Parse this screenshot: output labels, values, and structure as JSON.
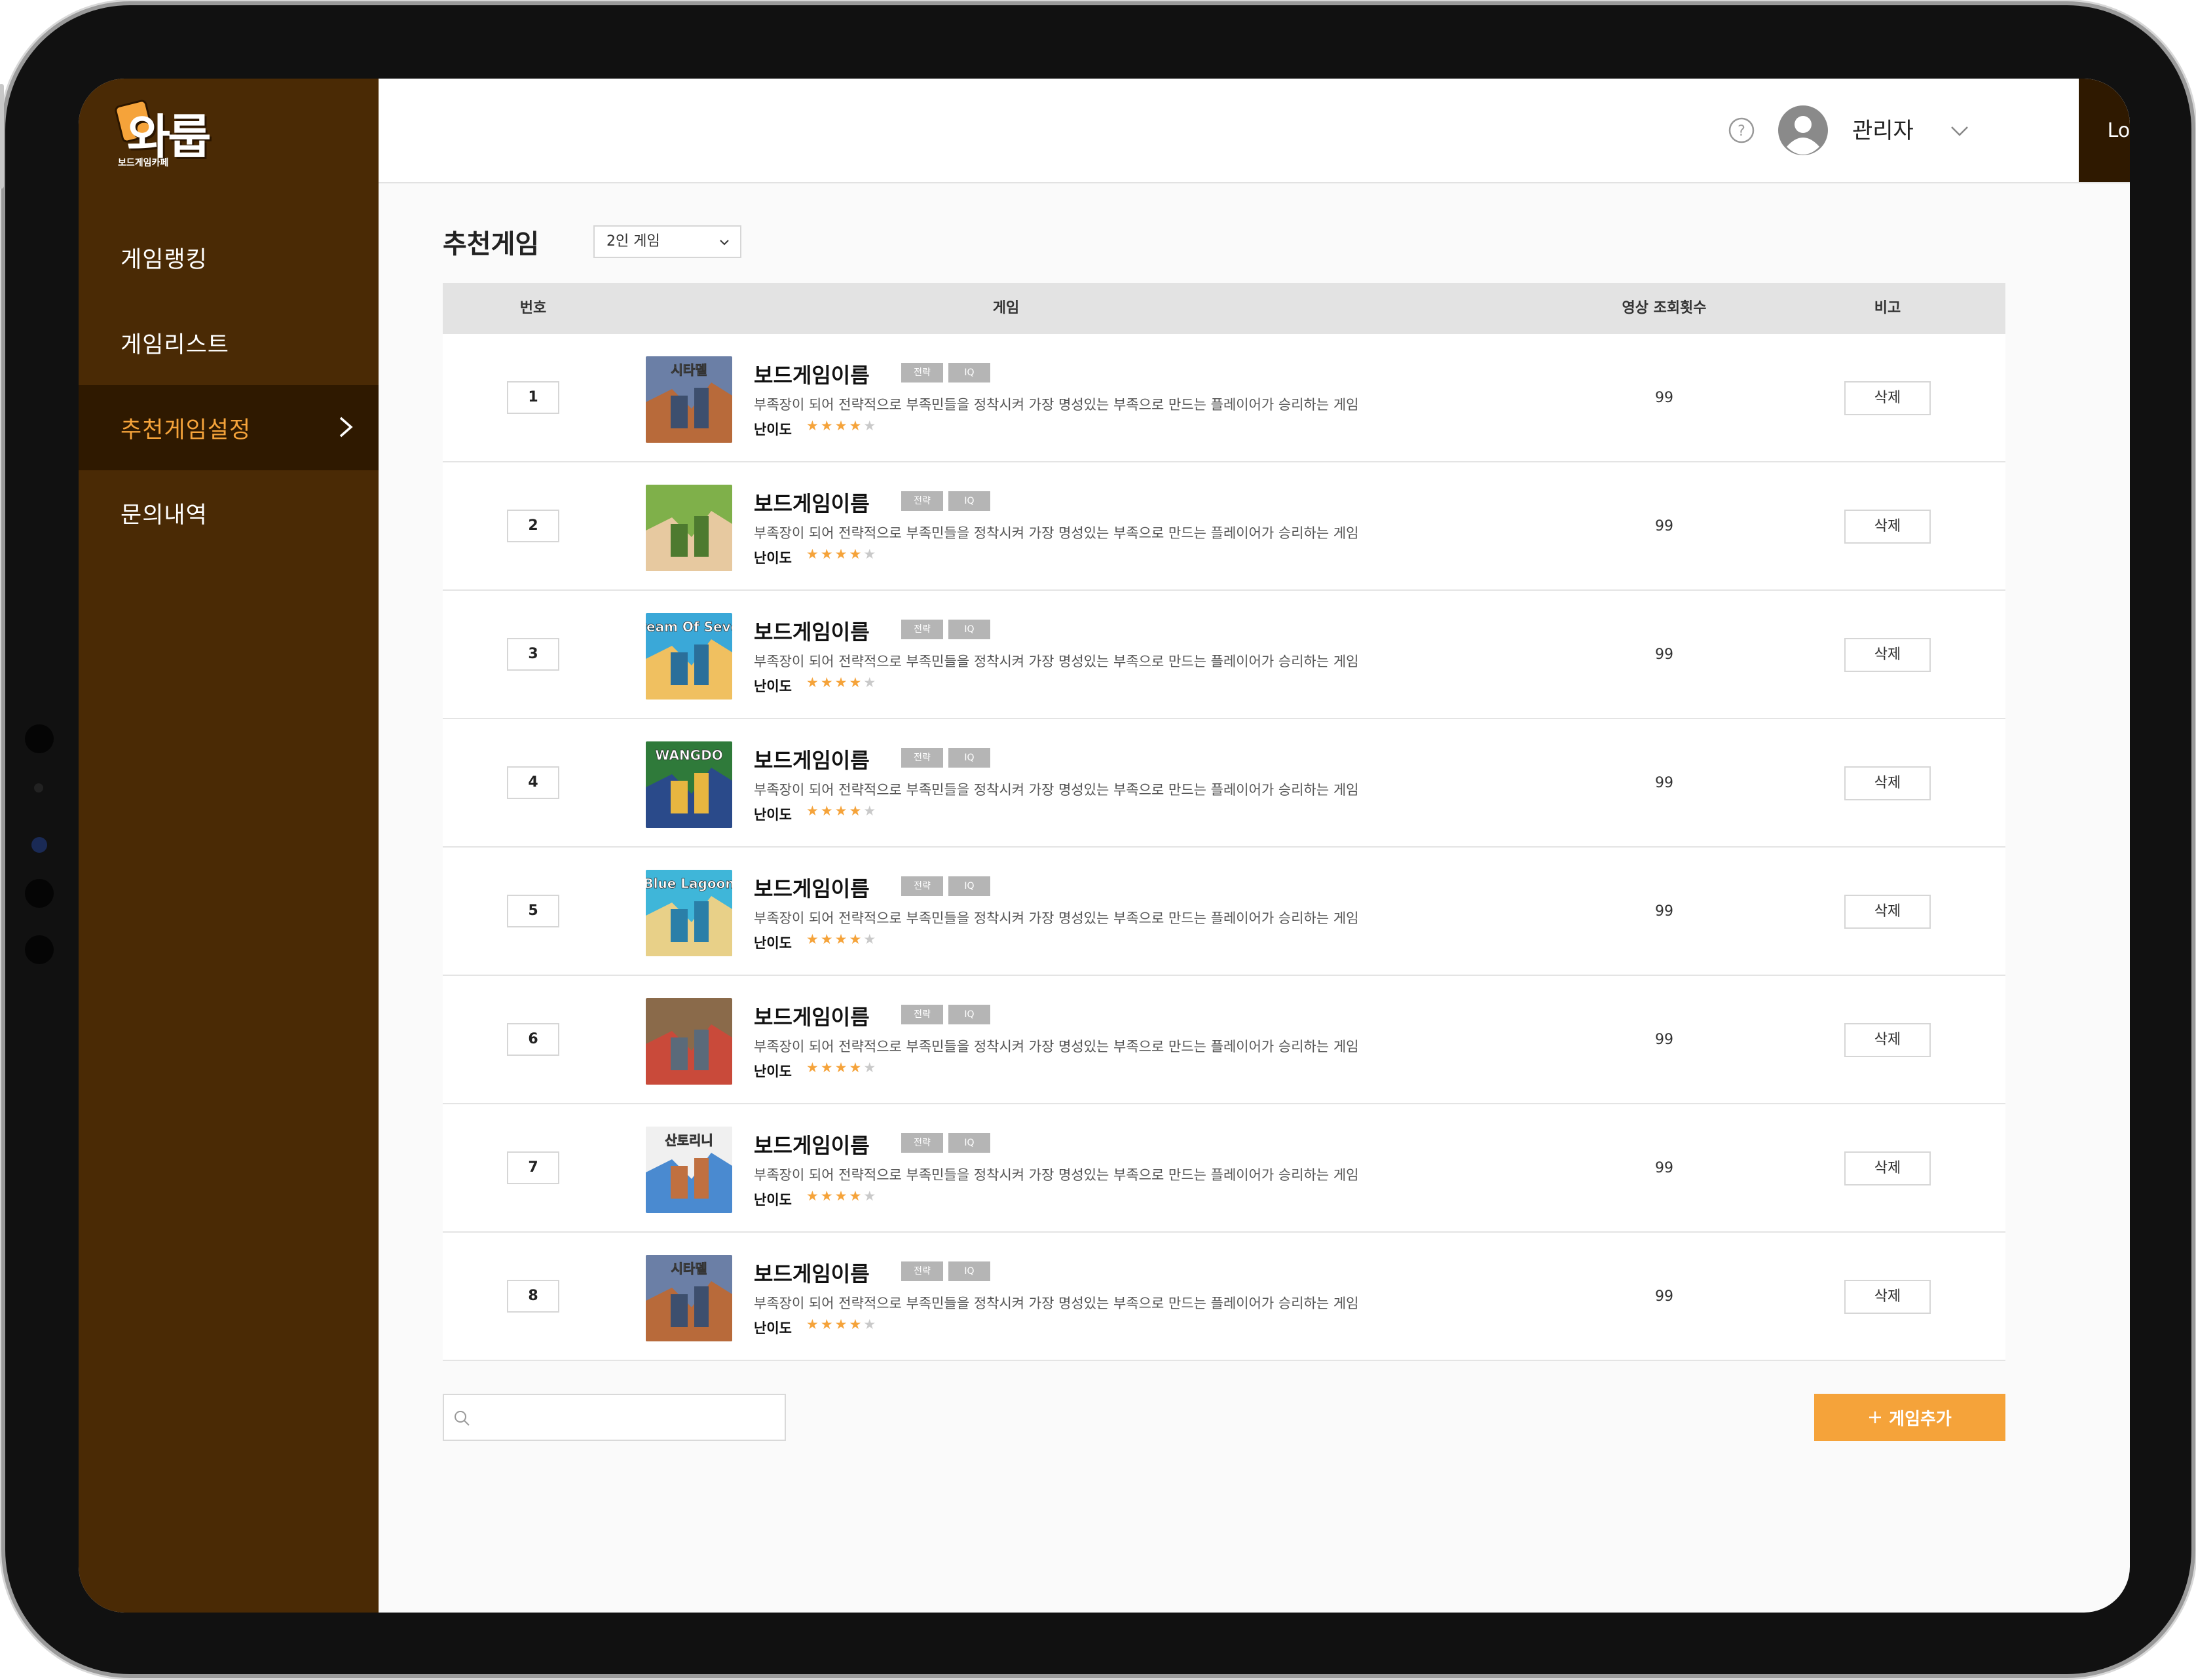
{
  "app": {
    "logo_main": "와룹",
    "logo_sub": "보드게임카페"
  },
  "sidebar": {
    "items": [
      {
        "label": "게임랭킹"
      },
      {
        "label": "게임리스트"
      },
      {
        "label": "추천게임설정"
      },
      {
        "label": "문의내역"
      }
    ],
    "active_index": 2
  },
  "header": {
    "user_name": "관리자",
    "logout_label": "Logout"
  },
  "page": {
    "title": "추천게임",
    "filter_selected": "2인 게임"
  },
  "table": {
    "headers": [
      "번호",
      "게임",
      "영상 조회횟수",
      "비고"
    ],
    "rows": [
      {
        "num": "1",
        "name": "보드게임이름",
        "tag1": "전략",
        "tag2": "IQ",
        "desc": "부족장이 되어 전략적으로 부족민들을 정착시켜 가장 명성있는 부족으로 만드는 플레이어가 승리하는 게임",
        "diff_label": "난이도",
        "stars": 4,
        "views": "99",
        "action": "삭제"
      },
      {
        "num": "2",
        "name": "보드게임이름",
        "tag1": "전략",
        "tag2": "IQ",
        "desc": "부족장이 되어 전략적으로 부족민들을 정착시켜 가장 명성있는 부족으로 만드는 플레이어가 승리하는 게임",
        "diff_label": "난이도",
        "stars": 4,
        "views": "99",
        "action": "삭제"
      },
      {
        "num": "3",
        "name": "보드게임이름",
        "tag1": "전략",
        "tag2": "IQ",
        "desc": "부족장이 되어 전략적으로 부족민들을 정착시켜 가장 명성있는 부족으로 만드는 플레이어가 승리하는 게임",
        "diff_label": "난이도",
        "stars": 4,
        "views": "99",
        "action": "삭제"
      },
      {
        "num": "4",
        "name": "보드게임이름",
        "tag1": "전략",
        "tag2": "IQ",
        "desc": "부족장이 되어 전략적으로 부족민들을 정착시켜 가장 명성있는 부족으로 만드는 플레이어가 승리하는 게임",
        "diff_label": "난이도",
        "stars": 4,
        "views": "99",
        "action": "삭제"
      },
      {
        "num": "5",
        "name": "보드게임이름",
        "tag1": "전략",
        "tag2": "IQ",
        "desc": "부족장이 되어 전략적으로 부족민들을 정착시켜 가장 명성있는 부족으로 만드는 플레이어가 승리하는 게임",
        "diff_label": "난이도",
        "stars": 4,
        "views": "99",
        "action": "삭제"
      },
      {
        "num": "6",
        "name": "보드게임이름",
        "tag1": "전략",
        "tag2": "IQ",
        "desc": "부족장이 되어 전략적으로 부족민들을 정착시켜 가장 명성있는 부족으로 만드는 플레이어가 승리하는 게임",
        "diff_label": "난이도",
        "stars": 4,
        "views": "99",
        "action": "삭제"
      },
      {
        "num": "7",
        "name": "보드게임이름",
        "tag1": "전략",
        "tag2": "IQ",
        "desc": "부족장이 되어 전략적으로 부족민들을 정착시켜 가장 명성있는 부족으로 만드는 플레이어가 승리하는 게임",
        "diff_label": "난이도",
        "stars": 4,
        "views": "99",
        "action": "삭제"
      },
      {
        "num": "8",
        "name": "보드게임이름",
        "tag1": "전략",
        "tag2": "IQ",
        "desc": "부족장이 되어 전략적으로 부족민들을 정착시켜 가장 명성있는 부족으로 만드는 플레이어가 승리하는 게임",
        "diff_label": "난이도",
        "stars": 4,
        "views": "99",
        "action": "삭제"
      }
    ],
    "max_stars": 5
  },
  "thumbnails": [
    {
      "text": "시타델",
      "colors": [
        "#6b7fa6",
        "#b86a3a",
        "#3d4f6e"
      ]
    },
    {
      "text": "",
      "colors": [
        "#7fb04a",
        "#e7c9a0",
        "#4d7a2f"
      ]
    },
    {
      "text": "Dream Of Seven",
      "colors": [
        "#3aa8d8",
        "#f0c060",
        "#2a6f9a"
      ]
    },
    {
      "text": "WANGDO",
      "colors": [
        "#2f7a3a",
        "#2a4a8a",
        "#e8b640"
      ]
    },
    {
      "text": "Blue Lagoon",
      "colors": [
        "#3fb6d9",
        "#e8d088",
        "#2a7fa8"
      ]
    },
    {
      "text": "",
      "colors": [
        "#8a6a4a",
        "#c94a3a",
        "#5a6a7a"
      ]
    },
    {
      "text": "산토리니",
      "colors": [
        "#f0f0f0",
        "#4a8ad0",
        "#c07040"
      ]
    },
    {
      "text": "시타델",
      "colors": [
        "#6b7fa6",
        "#b86a3a",
        "#3d4f6e"
      ]
    }
  ],
  "footer": {
    "search_placeholder": "",
    "add_label": "게임추가"
  },
  "colors": {
    "sidebar_bg": "#4a2a05",
    "sidebar_active": "#2f1900",
    "accent": "#f5a33a"
  }
}
